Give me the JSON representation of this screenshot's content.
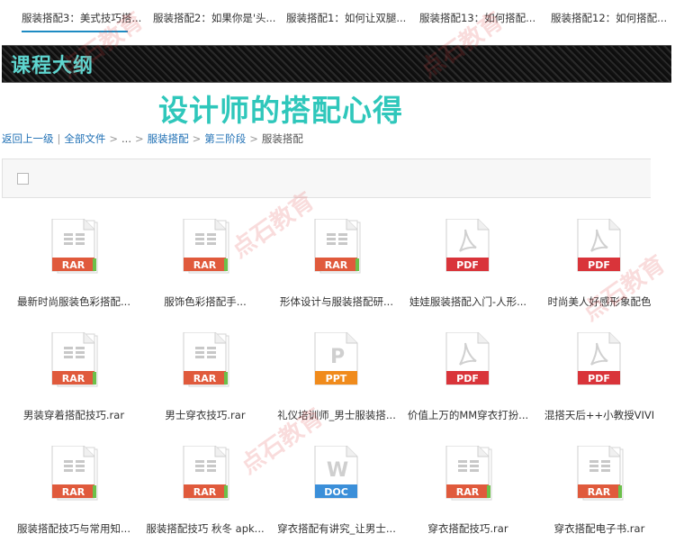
{
  "tabs": [
    {
      "label": "服装搭配3：美式技巧搭..."
    },
    {
      "label": "服装搭配2：如果你是'头..."
    },
    {
      "label": "服装搭配1：如何让双腿..."
    },
    {
      "label": "服装搭配13：如何搭配..."
    },
    {
      "label": "服装搭配12：如何搭配..."
    }
  ],
  "banner": {
    "title": "课程大纲"
  },
  "page_title": "设计师的搭配心得",
  "breadcrumb": {
    "back": "返回上一级",
    "all": "全部文件",
    "ellipsis": "...",
    "level1": "服装搭配",
    "level2": "第三阶段",
    "current": "服装搭配"
  },
  "watermark": "点石教育",
  "colors": {
    "rar": "#e05a3c",
    "pdf": "#d9343a",
    "ppt": "#f08b1c",
    "doc": "#3b8fd9",
    "accent": "#2fc7bb"
  },
  "files": [
    {
      "name": "最新时尚服装色彩搭配...",
      "type": "RAR"
    },
    {
      "name": "服饰色彩搭配手...",
      "type": "RAR"
    },
    {
      "name": "形体设计与服装搭配研...",
      "type": "RAR"
    },
    {
      "name": "娃娃服装搭配入门-人形...",
      "type": "PDF"
    },
    {
      "name": "时尚美人好感形象配色",
      "type": "PDF"
    },
    {
      "name": "男装穿着搭配技巧.rar",
      "type": "RAR"
    },
    {
      "name": "男士穿衣技巧.rar",
      "type": "RAR"
    },
    {
      "name": "礼仪培训师_男士服装搭...",
      "type": "PPT"
    },
    {
      "name": "价值上万的MM穿衣打扮...",
      "type": "PDF"
    },
    {
      "name": "混搭天后++小教授VIVI",
      "type": "PDF"
    },
    {
      "name": "服装搭配技巧与常用知...",
      "type": "RAR"
    },
    {
      "name": "服装搭配技巧 秋冬 apk...",
      "type": "RAR"
    },
    {
      "name": "穿衣搭配有讲究_让男士...",
      "type": "DOC"
    },
    {
      "name": "穿衣搭配技巧.rar",
      "type": "RAR"
    },
    {
      "name": "穿衣搭配电子书.rar",
      "type": "RAR"
    }
  ]
}
